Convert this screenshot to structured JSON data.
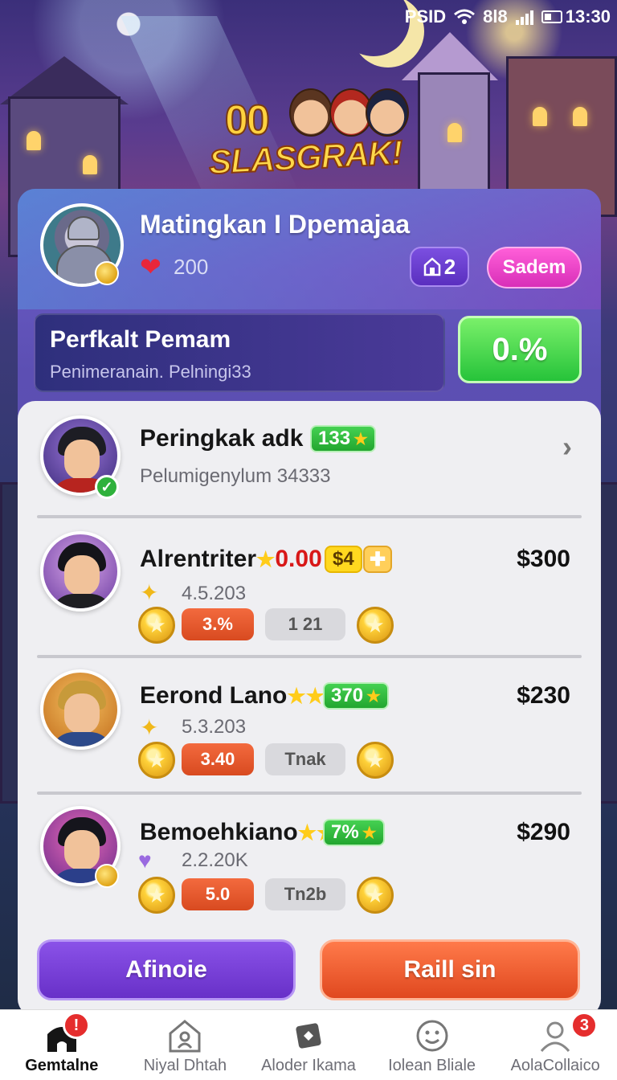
{
  "status_bar": {
    "carrier": "PSID",
    "signal_text": "8l8",
    "time": "13:30"
  },
  "logo": {
    "number": "00",
    "title": "SLASGRAK!"
  },
  "profile": {
    "name": "Matingkan I Dpemajaa",
    "likes": "200",
    "gift_count": "2",
    "action_label": "Sadem"
  },
  "banner": {
    "title": "Perfkalt Pemam",
    "subtitle": "Penimeranain. Pelningi33",
    "percent": "0.%"
  },
  "featured": {
    "name": "Peringkak adk",
    "badge": "133",
    "subtitle": "Pelumigenylum 34333"
  },
  "rows": [
    {
      "name": "Alrentriter",
      "stars": "★",
      "red_value": "0.00",
      "chip": "$4",
      "sub": "4.5.203",
      "price": "$300",
      "pill": "3.%",
      "gray": "1 21"
    },
    {
      "name": "Eerond Lano",
      "stars": "★★",
      "chip": "370",
      "sub": "5.3.203",
      "price": "$230",
      "pill": "3.40",
      "gray": "Tnak"
    },
    {
      "name": "Bemoehkiano",
      "stars": "★★",
      "chip": "7%",
      "sub": "2.2.20K",
      "price": "$290",
      "pill": "5.0",
      "gray": "Tn2b"
    }
  ],
  "buttons": {
    "left": "Afinoie",
    "right": "Raill sin"
  },
  "nav": [
    {
      "label": "Gemtalne",
      "icon": "home-icon",
      "badge": "!"
    },
    {
      "label": "Niyal Dhtah",
      "icon": "house-user-icon"
    },
    {
      "label": "Aloder Ikama",
      "icon": "puzzle-icon"
    },
    {
      "label": "Iolean Bliale",
      "icon": "smiley-icon"
    },
    {
      "label": "AolaCollaico",
      "icon": "user-icon",
      "badge": "3"
    }
  ],
  "colors": {
    "accent_purple": "#6830c8",
    "accent_orange": "#e0481f",
    "accent_green": "#26c33a",
    "panel": "#efeff2"
  }
}
